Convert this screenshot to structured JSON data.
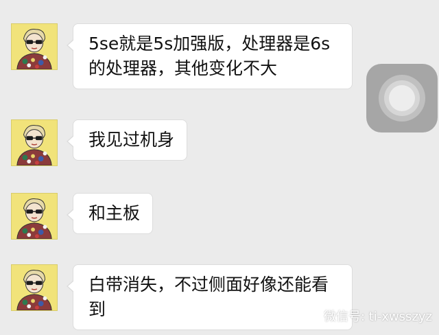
{
  "messages": [
    {
      "text": "5se就是5s加强版，处理器是6s的处理器，其他变化不大"
    },
    {
      "text": "我见过机身"
    },
    {
      "text": "和主板"
    },
    {
      "text": "白带消失，不过侧面好像还能看到"
    }
  ],
  "watermark": {
    "text": "微信号: ti-xwsszyz",
    "icon": "wechat-icon"
  },
  "icons": {
    "avatar": "avatar-icon",
    "assistive_touch": "assistive-touch-icon"
  },
  "colors": {
    "background": "#ebebeb",
    "bubble": "#ffffff",
    "avatar_bg": "#f1e37a"
  }
}
